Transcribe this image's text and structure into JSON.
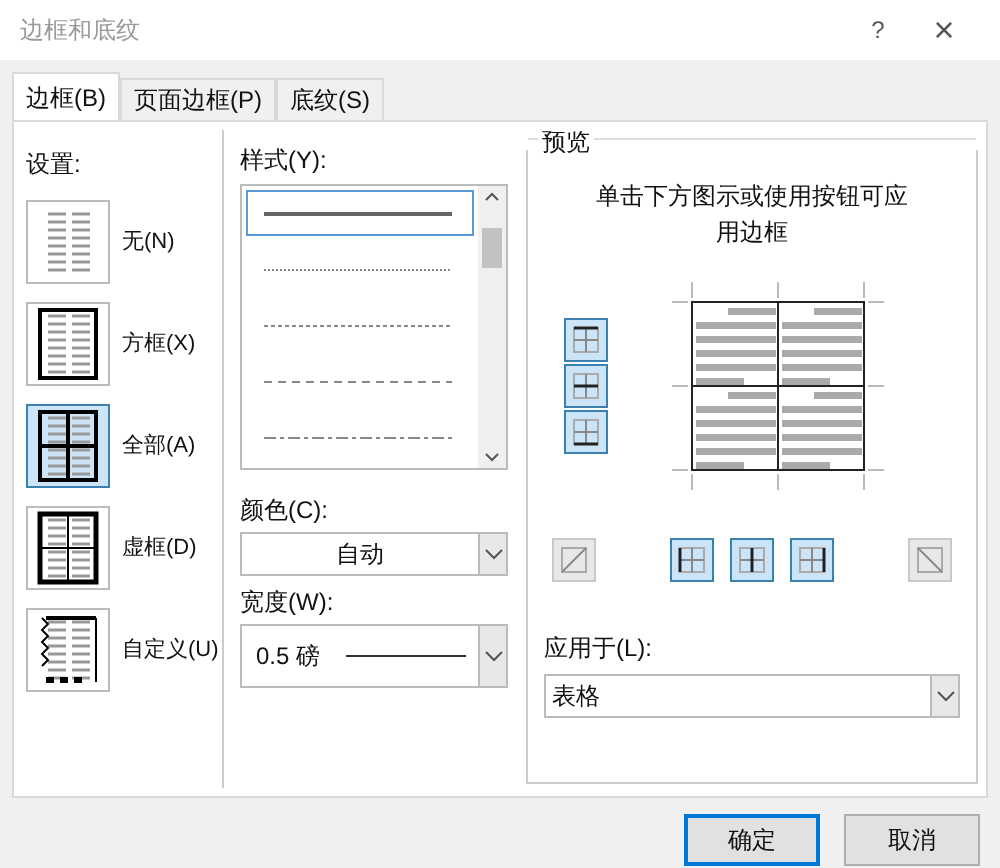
{
  "window": {
    "title": "边框和底纹",
    "help": "?",
    "close": "×"
  },
  "tabs": [
    {
      "label": "边框(B)",
      "selected": true
    },
    {
      "label": "页面边框(P)",
      "selected": false
    },
    {
      "label": "底纹(S)",
      "selected": false
    }
  ],
  "settings": {
    "label": "设置:",
    "items": [
      {
        "kind": "none",
        "label": "无(N)",
        "selected": false
      },
      {
        "kind": "box",
        "label": "方框(X)",
        "selected": false
      },
      {
        "kind": "all",
        "label": "全部(A)",
        "selected": true
      },
      {
        "kind": "grid",
        "label": "虚框(D)",
        "selected": false
      },
      {
        "kind": "custom",
        "label": "自定义(U)",
        "selected": false
      }
    ]
  },
  "style": {
    "label": "样式(Y):",
    "items": [
      {
        "kind": "solid",
        "selected": true
      },
      {
        "kind": "dotted",
        "selected": false
      },
      {
        "kind": "fine-dash",
        "selected": false
      },
      {
        "kind": "dash",
        "selected": false
      },
      {
        "kind": "dash-dot",
        "selected": false
      }
    ]
  },
  "color": {
    "label": "颜色(C):",
    "value": "自动"
  },
  "width": {
    "label": "宽度(W):",
    "value": "0.5 磅"
  },
  "preview": {
    "label": "预览",
    "hint": "单击下方图示或使用按钮可应用边框",
    "side_buttons": [
      {
        "kind": "top",
        "on": true
      },
      {
        "kind": "middle",
        "on": true
      },
      {
        "kind": "bottom",
        "on": true
      }
    ],
    "bottom_buttons": [
      {
        "kind": "diag-up",
        "on": false
      },
      {
        "kind": "left",
        "on": true
      },
      {
        "kind": "center",
        "on": true
      },
      {
        "kind": "right",
        "on": true
      },
      {
        "kind": "diag-down",
        "on": false
      }
    ]
  },
  "apply_to": {
    "label": "应用于(L):",
    "value": "表格"
  },
  "buttons": [
    {
      "label": "确定",
      "kind": "default"
    },
    {
      "label": "取消",
      "kind": "normal"
    }
  ]
}
